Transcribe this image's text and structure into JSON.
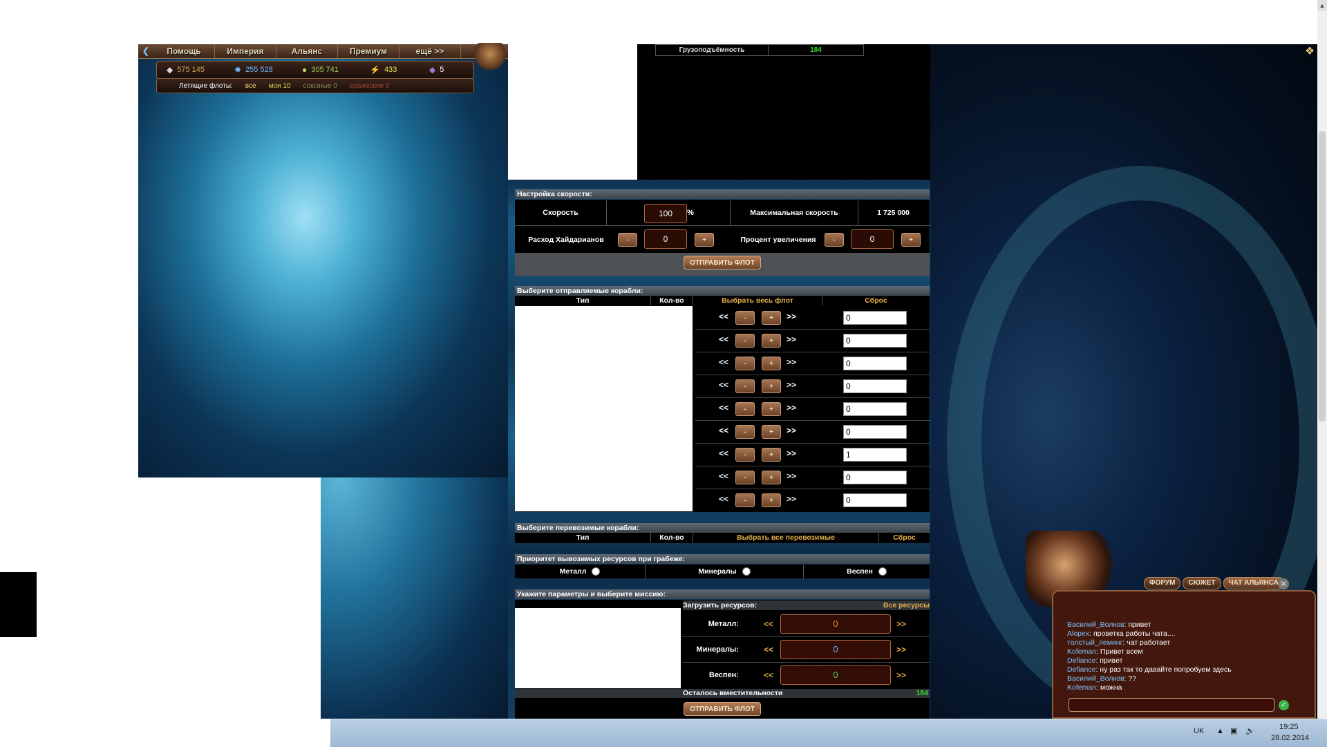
{
  "nav": {
    "help": "Помощь",
    "empire": "Империя",
    "alliance": "Альянс",
    "premium": "Премиум",
    "more": "ещё >>"
  },
  "resources": {
    "metal": "575 145",
    "minerals": "255 528",
    "vespene": "305 741",
    "energy": "433",
    "crystals": "5"
  },
  "fleets": {
    "label": "Летящие флоты:",
    "all": "все",
    "mine": "мои 10",
    "allied": "союзные 0",
    "enemy": "вражеские 0"
  },
  "cargo": {
    "label": "Грузоподъёмность",
    "value": "184"
  },
  "speed_section": {
    "title": "Настройка скорости:",
    "speed_label": "Скорость",
    "speed_value": "100",
    "percent": "%",
    "max_speed_label": "Максимальная скорость",
    "max_speed_value": "1 725 000",
    "hydarian_label": "Расход Хайдарианов",
    "hydarian_value": "0",
    "increase_label": "Процент увеличения",
    "increase_value": "0",
    "minus": "-",
    "plus": "+",
    "send_button": "ОТПРАВИТЬ ФЛОТ"
  },
  "ships_section": {
    "title": "Выберите отправляемые корабли:",
    "col_type": "Тип",
    "col_qty": "Кол-во",
    "select_all": "Выбрать весь флот",
    "reset": "Сброс",
    "arrow_left": "<<",
    "arrow_right": ">>",
    "rows": [
      "0",
      "0",
      "0",
      "0",
      "0",
      "0",
      "1",
      "0",
      "0"
    ]
  },
  "transport_section": {
    "title": "Выберите перевозимые корабли:",
    "col_type": "Тип",
    "col_qty": "Кол-во",
    "select_all": "Выбрать все перевозимые",
    "reset": "Сброс"
  },
  "priority_section": {
    "title": "Приоритет вывозимых ресурсов при грабеже:",
    "metal": "Металл",
    "minerals": "Минералы",
    "vespene": "Веспен"
  },
  "mission_section": {
    "title": "Укажите параметры и выберите миссию:",
    "load_label": "Загрузить ресурсов:",
    "all_resources": "Все ресурсы",
    "metal_label": "Металл:",
    "metal_value": "0",
    "minerals_label": "Минералы:",
    "minerals_value": "0",
    "vespene_label": "Веспен:",
    "vespene_value": "0",
    "arrow_left": "<<",
    "arrow_right": ">>",
    "capacity_label": "Осталось вместительности",
    "capacity_value": "184",
    "send_button": "ОТПРАВИТЬ ФЛОТ"
  },
  "chat": {
    "tabs": [
      "ФОРУМ",
      "СЮЖЕТ",
      "ЧАТ АЛЬЯНСА"
    ],
    "messages": [
      {
        "nick": "Василий_Волков",
        "text": ": привет"
      },
      {
        "nick": "Alopex",
        "text": ": проветка работы чата...."
      },
      {
        "nick": "толстый_леминг",
        "text": ": чат работает"
      },
      {
        "nick": "Kofeman",
        "text": ": Привет всем"
      },
      {
        "nick": "Defiance",
        "text": ": привет"
      },
      {
        "nick": "Defiance",
        "text": ": ну раз так то давайте попробуем здесь"
      },
      {
        "nick": "Василий_Волков",
        "text": ": ??"
      },
      {
        "nick": "Kofeman",
        "text": ": можна"
      }
    ]
  },
  "taskbar": {
    "lang": "UK",
    "time": "19:25",
    "date": "28.02.2014"
  },
  "colors": {
    "green": "#33dd33",
    "gold": "#e4b04a",
    "nick": "#7fc6ff"
  }
}
